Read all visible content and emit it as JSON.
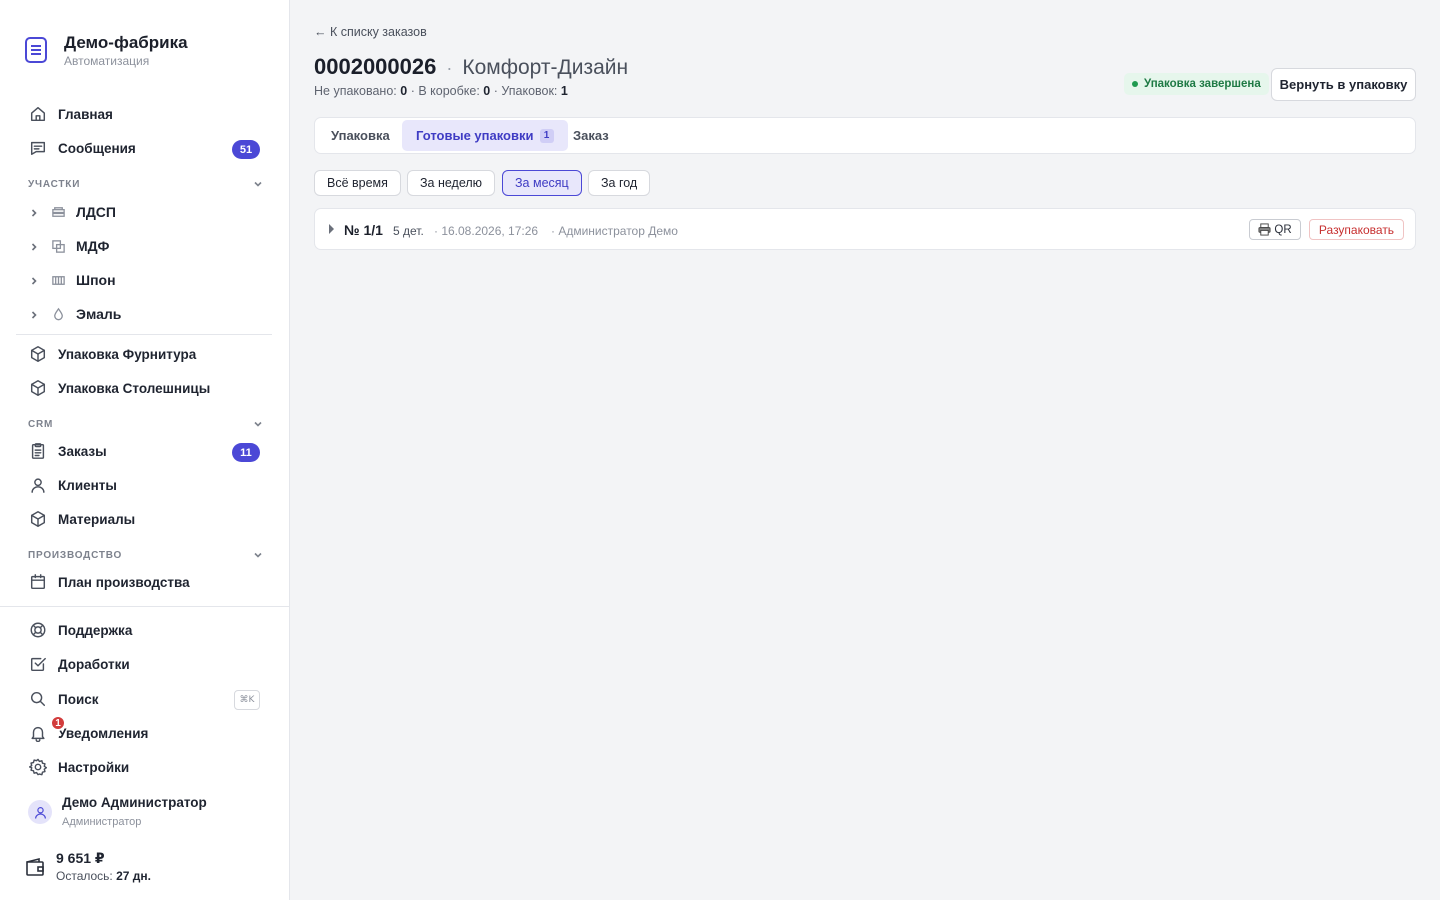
{
  "brand": {
    "title": "Демо-фабрика",
    "subtitle": "Автоматизация"
  },
  "nav": {
    "home": "Главная",
    "messages": {
      "label": "Сообщения",
      "badge": "51"
    },
    "sections": {
      "areas": "Участки",
      "crm": "CRM",
      "production": "Производство"
    },
    "areas": [
      {
        "label": "ЛДСП",
        "icon": "layers-icon"
      },
      {
        "label": "МДФ",
        "icon": "copy-icon"
      },
      {
        "label": "Шпон",
        "icon": "veneer-icon"
      },
      {
        "label": "Эмаль",
        "icon": "drop-icon"
      }
    ],
    "pack_furniture": "Упаковка Фурнитура",
    "pack_tops": "Упаковка Столешницы",
    "orders": {
      "label": "Заказы",
      "badge": "11"
    },
    "clients": "Клиенты",
    "materials": "Материалы",
    "plan": "План производства",
    "support": "Поддержка",
    "improvements": "Доработки",
    "search": {
      "label": "Поиск",
      "shortcut": "⌘K"
    },
    "notifications": {
      "label": "Уведомления",
      "badge": "1"
    },
    "settings": "Настройки"
  },
  "user": {
    "name": "Демо Администратор",
    "role": "Администратор"
  },
  "wallet": {
    "amount": "9 651 ₽",
    "left_label": "Осталось:",
    "left_value": "27 дн."
  },
  "page": {
    "back_link": "← К списку заказов",
    "order_number": "0002000026",
    "separator": "·",
    "client": "Комфорт-Дизайн",
    "stats": {
      "unpacked_label": "Не упаковано:",
      "unpacked": "0",
      "boxed_label": "· В коробке:",
      "boxed": "0",
      "packs_label": "· Упаковок:",
      "packs": "1"
    },
    "status": "Упаковка завершена",
    "return_button": "Вернуть в упаковку",
    "tabs": [
      {
        "label": "Упаковка"
      },
      {
        "label": "Готовые упаковки",
        "count": "1"
      },
      {
        "label": "Заказ"
      }
    ],
    "filters": [
      "Всё время",
      "За неделю",
      "За месяц",
      "За год"
    ],
    "packages": [
      {
        "number": "№ 1/1",
        "details": "5 дет.",
        "date": "· 16.08.2026, 17:26",
        "user": "· Администратор Демо",
        "qr_label": "QR",
        "unpack_label": "Разупаковать"
      }
    ]
  },
  "colors": {
    "accent": "#4b48d6",
    "success": "#1f7a45",
    "danger": "#c72f2f"
  }
}
